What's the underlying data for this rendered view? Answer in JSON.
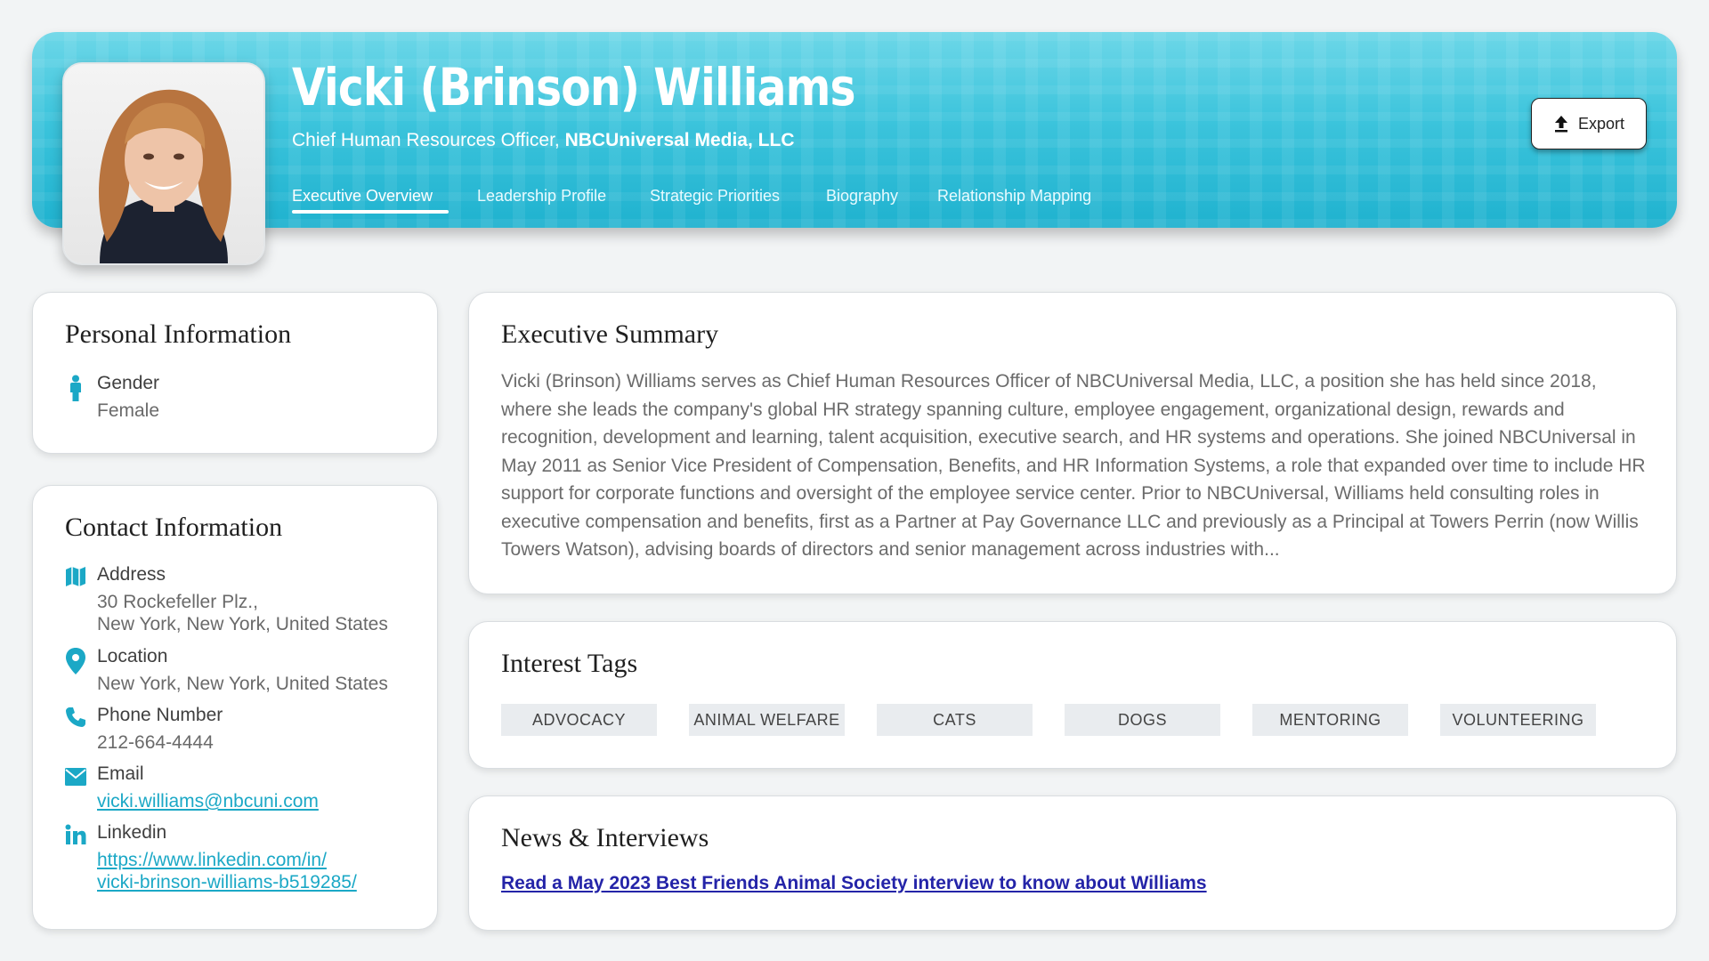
{
  "profile": {
    "name": "Vicki (Brinson) Williams",
    "title": "Chief Human Resources Officer,",
    "company": "NBCUniversal Media, LLC",
    "photo_alt": "Vicki (Brinson) Williams"
  },
  "tabs": [
    {
      "label": "Executive Overview",
      "active": true
    },
    {
      "label": "Leadership Profile",
      "active": false
    },
    {
      "label": "Strategic Priorities",
      "active": false
    },
    {
      "label": "Biography",
      "active": false
    },
    {
      "label": "Relationship Mapping",
      "active": false
    }
  ],
  "export": {
    "label": "Export",
    "icon": "upload-icon"
  },
  "personal": {
    "title": "Personal Information",
    "gender_label": "Gender",
    "gender_value": "Female",
    "gender_icon": "person-icon"
  },
  "contact": {
    "title": "Contact Information",
    "address_label": "Address",
    "address_line1": "30 Rockefeller Plz.,",
    "address_line2": "New York, New York, United States",
    "location_label": "Location",
    "location_value": "New York, New York, United States",
    "phone_label": "Phone Number",
    "phone_value": "212-664-4444",
    "email_label": "Email",
    "email_value": "vicki.williams@nbcuni.com",
    "linkedin_label": "Linkedin",
    "linkedin_line1": "https://www.linkedin.com/in/",
    "linkedin_line2": "vicki-brinson-williams-b519285/"
  },
  "summary": {
    "title": "Executive Summary",
    "text": "Vicki (Brinson) Williams serves as Chief Human Resources Officer of NBCUniversal Media, LLC, a position she has held since 2018, where she leads the company's global HR strategy spanning culture, employee engagement, organizational design, rewards and recognition, development and learning, talent acquisition, executive search, and HR systems and operations. She joined NBCUniversal in May 2011 as Senior Vice President of Compensation, Benefits, and HR Information Systems, a role that expanded over time to include HR support for corporate functions and oversight of the employee service center. Prior to NBCUniversal, Williams held consulting roles in executive compensation and benefits, first as a Partner at Pay Governance LLC and previously as a Principal at Towers Perrin (now Willis Towers Watson), advising boards of directors and senior management across industries with..."
  },
  "interests": {
    "title": "Interest Tags",
    "tags": [
      "ADVOCACY",
      "ANIMAL WELFARE",
      "CATS",
      "DOGS",
      "MENTORING",
      "VOLUNTEERING"
    ]
  },
  "news": {
    "title": "News & Interviews",
    "link_text": "Read a May 2023 Best Friends Animal Society interview to know about Williams"
  },
  "colors": {
    "accent": "#1ba8c6",
    "header": "#3cc4dc",
    "link": "#2424a8"
  }
}
